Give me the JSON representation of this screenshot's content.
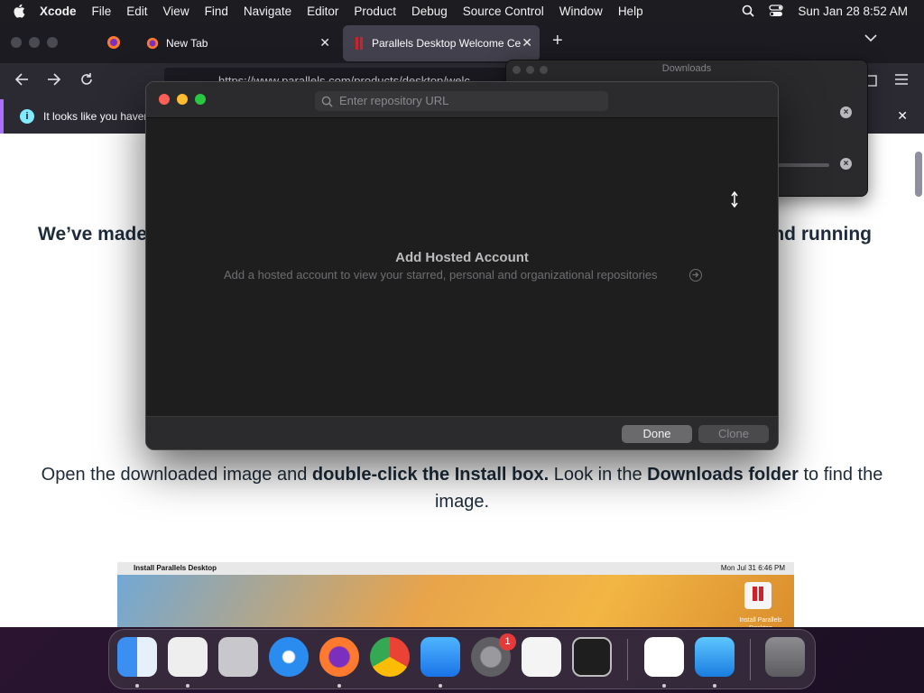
{
  "menubar": {
    "app_name": "Xcode",
    "items": [
      "File",
      "Edit",
      "View",
      "Find",
      "Navigate",
      "Editor",
      "Product",
      "Debug",
      "Source Control",
      "Window",
      "Help"
    ],
    "clock": "Sun Jan 28  8:52 AM"
  },
  "browser": {
    "tabs": [
      {
        "title": "New Tab"
      },
      {
        "title": "Parallels Desktop Welcome Cen"
      }
    ],
    "url": "https://www.parallels.com/products/desktop/welc",
    "notice_text": "It looks like you haven't",
    "page": {
      "heading_left": "We’ve made",
      "heading_right": "nd running",
      "paragraph_parts": [
        "Open the downloaded image and ",
        "double-click the Install box.",
        " Look in the ",
        "Downloads folder",
        " to find the image."
      ],
      "preview_menubar_app": "Install Parallels Desktop",
      "preview_clock": "Mon Jul 31  6:46 PM",
      "preview_icon_label": "Install Parallels Desktop"
    }
  },
  "downloads": {
    "title": "Downloads"
  },
  "clone_dialog": {
    "search_placeholder": "Enter repository URL",
    "empty_title": "Add Hosted Account",
    "empty_subtitle": "Add a hosted account to view your starred, personal and organizational repositories",
    "done_label": "Done",
    "clone_label": "Clone"
  },
  "dock": {
    "apps": [
      "Finder",
      "Parallels Desktop",
      "Launchpad",
      "Safari",
      "Firefox",
      "Chrome",
      "App Store",
      "System Settings",
      "TextEdit",
      "Terminal",
      "Visual Studio",
      "Xcode",
      "Trash"
    ],
    "settings_badge": "1"
  },
  "colors": {
    "accent_purple": "#a970ff",
    "traffic_red": "#fe5f57",
    "traffic_yellow": "#febc2e",
    "traffic_green": "#28c840"
  }
}
